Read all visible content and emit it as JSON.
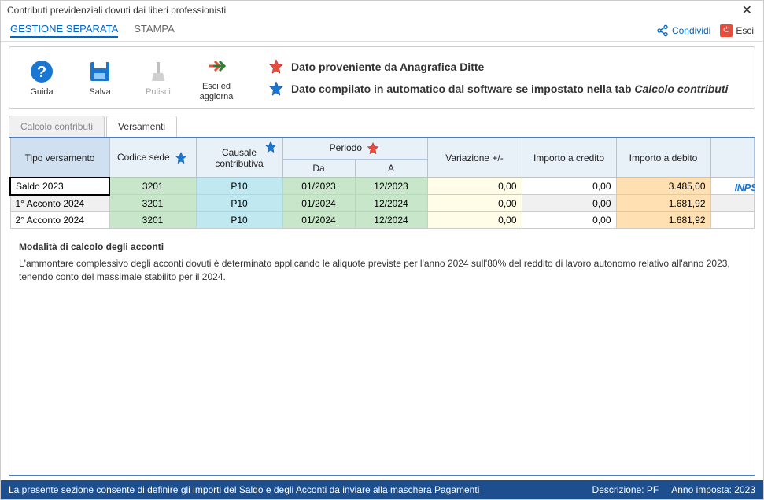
{
  "window_title": "Contributi previdenziali dovuti dai liberi professionisti",
  "menu": {
    "gestione": "GESTIONE SEPARATA",
    "stampa": "STAMPA",
    "condividi": "Condividi",
    "esci": "Esci"
  },
  "toolbar": {
    "guida": "Guida",
    "salva": "Salva",
    "pulisci": "Pulisci",
    "esci_aggiorna": "Esci ed\naggiorna"
  },
  "legend": {
    "red": "Dato proveniente da Anagrafica Ditte",
    "blue_prefix": "Dato compilato in automatico dal software se impostato nella tab ",
    "blue_em": "Calcolo contributi"
  },
  "tabs": {
    "calcolo": "Calcolo contributi",
    "versamenti": "Versamenti"
  },
  "table": {
    "headers": {
      "tipo": "Tipo versamento",
      "codice": "Codice sede",
      "causale": "Causale\ncontributiva",
      "periodo": "Periodo",
      "da": "Da",
      "a": "A",
      "variazione": "Variazione +/-",
      "credito": "Importo a credito",
      "debito": "Importo a debito"
    },
    "rows": [
      {
        "tipo": "Saldo 2023",
        "codice": "3201",
        "causale": "P10",
        "da": "01/2023",
        "a": "12/2023",
        "variazione": "0,00",
        "credito": "0,00",
        "debito": "3.485,00"
      },
      {
        "tipo": "1° Acconto 2024",
        "codice": "3201",
        "causale": "P10",
        "da": "01/2024",
        "a": "12/2024",
        "variazione": "0,00",
        "credito": "0,00",
        "debito": "1.681,92"
      },
      {
        "tipo": "2° Acconto 2024",
        "codice": "3201",
        "causale": "P10",
        "da": "01/2024",
        "a": "12/2024",
        "variazione": "0,00",
        "credito": "0,00",
        "debito": "1.681,92"
      }
    ]
  },
  "inps_label": "INPS",
  "notes": {
    "title": "Modalità di calcolo degli acconti",
    "body": "L'ammontare complessivo degli acconti dovuti è determinato applicando le aliquote previste per l'anno 2024 sull'80% del reddito di lavoro autonomo relativo all'anno 2023, tenendo conto del massimale stabilito per il 2024."
  },
  "statusbar": {
    "left": "La presente sezione consente di definire gli importi del Saldo e degli Acconti da inviare alla maschera Pagamenti",
    "descrizione": "Descrizione: PF",
    "anno": "Anno imposta: 2023"
  }
}
